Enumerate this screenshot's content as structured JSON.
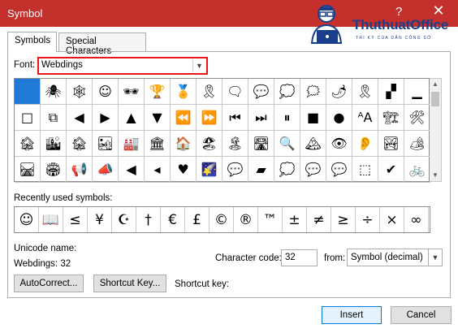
{
  "window": {
    "title": "Symbol",
    "help": "?",
    "close": "✕"
  },
  "watermark": {
    "brand": "ThuthuatOffice",
    "tagline": "TRI KỲ CỦA DÂN CÔNG SỞ"
  },
  "tabs": [
    {
      "label": "Symbols",
      "active": true
    },
    {
      "label": "Special Characters",
      "active": false
    }
  ],
  "font": {
    "label": "Font:",
    "value": "Webdings"
  },
  "grid": {
    "rows": [
      [
        "",
        "🕷",
        "🕸",
        "☺",
        "🕶",
        "🏆",
        "🏅",
        "🎗",
        "🗨",
        "💬",
        "💭",
        "🗯",
        "🌶",
        "🎗",
        "▞",
        "▁"
      ],
      [
        "□",
        "⧉",
        "◀",
        "▶",
        "▲",
        "▼",
        "⏪",
        "⏩",
        "⏮",
        "⏭",
        "⏸",
        "■",
        "●",
        "ᴬA",
        "🏗",
        "🛠"
      ],
      [
        "🏚",
        "🏙",
        "🏚",
        "🏜",
        "🏭",
        "🏛",
        "🏠",
        "🏖",
        "🏝",
        "🛣",
        "🔍",
        "🏔",
        "👁",
        "👂",
        "🏞",
        "🏕"
      ],
      [
        "🛤",
        "🏟",
        "📢",
        "📣",
        "◀",
        "◂",
        "♥",
        "🌠",
        "💬",
        "▰",
        "💭",
        "💬",
        "💬",
        "⬚",
        "✔",
        "🚲"
      ]
    ],
    "selected_index": 0
  },
  "recent": {
    "label": "Recently used symbols:",
    "symbols": [
      "☺",
      "📖",
      "≤",
      "¥",
      "☪",
      "†",
      "€",
      "£",
      "©",
      "®",
      "™",
      "±",
      "≠",
      "≥",
      "÷",
      "×",
      "∞"
    ]
  },
  "unicode": {
    "label": "Unicode name:",
    "value": "Webdings: 32"
  },
  "charcode": {
    "label": "Character code:",
    "value": "32"
  },
  "from": {
    "label": "from:",
    "value": "Symbol (decimal)"
  },
  "buttons": {
    "autocorrect": "AutoCorrect...",
    "shortcut_key": "Shortcut Key...",
    "insert": "Insert",
    "cancel": "Cancel"
  },
  "shortcut_key_label": "Shortcut key:",
  "colors": {
    "titlebar": "#c4302b",
    "selected": "#1e7ad6",
    "font_highlight": "#e8151b"
  }
}
